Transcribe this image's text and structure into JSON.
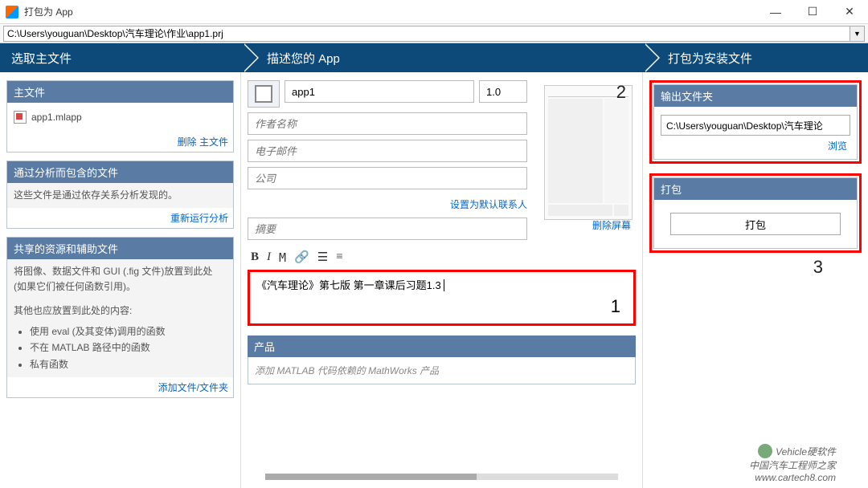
{
  "window": {
    "title": "打包为 App",
    "minimize": "—",
    "maximize": "☐",
    "close": "✕"
  },
  "path": "C:\\Users\\youguan\\Desktop\\汽车理论\\作业\\app1.prj",
  "steps": {
    "s1": "选取主文件",
    "s2": "描述您的 App",
    "s3": "打包为安装文件"
  },
  "col1": {
    "main_file_hd": "主文件",
    "main_file": "app1.mlapp",
    "delete_main": "删除 主文件",
    "included_hd": "通过分析而包含的文件",
    "included_txt": "这些文件是通过依存关系分析发现的。",
    "rerun": "重新运行分析",
    "shared_hd": "共享的资源和辅助文件",
    "shared_txt1": "将图像、数据文件和 GUI (.fig 文件)放置到此处 (如果它们被任何函数引用)。",
    "shared_txt2": "其他也应放置到此处的内容:",
    "b1": "使用 eval (及其变体)调用的函数",
    "b2": "不在 MATLAB 路径中的函数",
    "b3": "私有函数",
    "add_files": "添加文件/文件夹"
  },
  "col2": {
    "app_name": "app1",
    "version": "1.0",
    "author_ph": "作者名称",
    "email_ph": "电子邮件",
    "company_ph": "公司",
    "set_default": "设置为默认联系人",
    "summary_ph": "摘要",
    "thumb_del": "删除屏幕",
    "desc": "《汽车理论》第七版 第一章课后习题1.3",
    "prod_hd": "产品",
    "prod_txt": "添加 MATLAB 代码依赖的 MathWorks 产品",
    "annot1": "1",
    "annot2": "2"
  },
  "col3": {
    "out_hd": "输出文件夹",
    "out_path": "C:\\Users\\youguan\\Desktop\\汽车理论",
    "browse": "浏览",
    "pack_hd": "打包",
    "pack_btn": "打包",
    "annot3": "3"
  },
  "watermark": {
    "line1": "Vehicle硬软件",
    "line2": "中国汽车工程师之家",
    "line3": "www.cartech8.com"
  },
  "toolbar": {
    "bold": "B",
    "italic": "I",
    "mono": "M",
    "link": "🔗",
    "list": "☰",
    "num": "≡"
  }
}
